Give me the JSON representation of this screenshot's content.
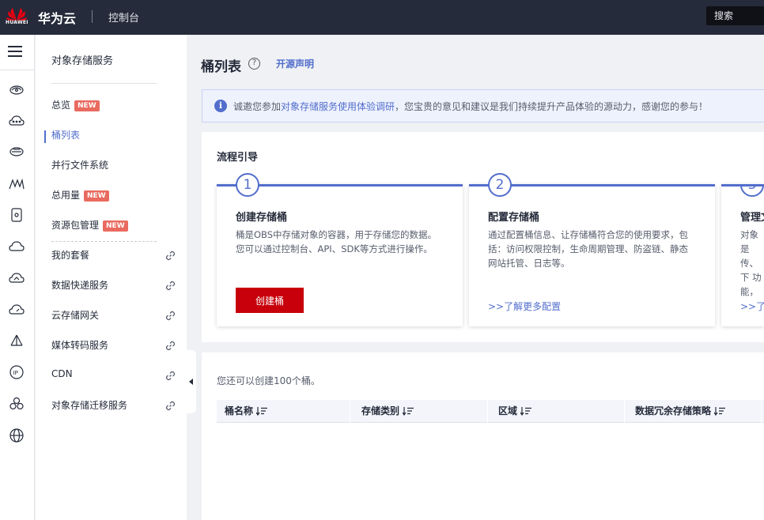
{
  "topbar": {
    "logo_text": "HUAWEI",
    "brand": "华为云",
    "console": "控制台",
    "search_placeholder": "搜索"
  },
  "rail_icons": [
    "menu-icon",
    "obs-icon",
    "cloud-dots-icon",
    "storage-icon",
    "mountain-icon",
    "drive-icon",
    "cloud-icon",
    "cloud-up-icon",
    "cloud-gauge-icon",
    "network-icon",
    "ip-icon",
    "cluster-icon",
    "globe-icon"
  ],
  "subnav": {
    "title": "对象存储服务",
    "items": [
      {
        "label": "总览",
        "badge": "NEW"
      },
      {
        "label": "桶列表",
        "active": true
      },
      {
        "label": "并行文件系统"
      },
      {
        "label": "总用量",
        "badge": "NEW"
      },
      {
        "label": "资源包管理",
        "badge": "NEW"
      },
      {
        "label": "我的套餐",
        "external": true
      },
      {
        "label": "数据快递服务",
        "external": true
      },
      {
        "label": "云存储网关",
        "external": true
      },
      {
        "label": "媒体转码服务",
        "external": true
      },
      {
        "label": "CDN",
        "external": true
      },
      {
        "label": "对象存储迁移服务",
        "external": true
      }
    ]
  },
  "header": {
    "title": "桶列表",
    "help_icon": "?",
    "open_source_link": "开源声明"
  },
  "notice": {
    "info_icon": "i",
    "prefix": "诚邀您参加",
    "link": "对象存储服务使用体验调研",
    "suffix": "，您宝贵的意见和建议是我们持续提升产品体验的源动力，感谢您的参与！"
  },
  "guide": {
    "title": "流程引导",
    "steps": [
      {
        "num": "1",
        "title": "创建存储桶",
        "desc": "桶是OBS中存储对象的容器，用于存储您的数据。您可以通过控制台、API、SDK等方式进行操作。",
        "button": "创建桶"
      },
      {
        "num": "2",
        "title": "配置存储桶",
        "desc": "通过配置桶信息、让存储桶符合您的使用要求，包括：访问权限控制，生命周期管理、防盗链、静态网站托管、日志等。",
        "link": ">>了解更多配置"
      },
      {
        "num": "3",
        "title": "管理文",
        "desc": "对象是 传、下 功能，",
        "link": ">>了解"
      }
    ]
  },
  "buckets": {
    "quota_text": "您还可以创建100个桶。",
    "columns": [
      "桶名称",
      "存储类别",
      "区域",
      "数据冗余存储策略"
    ]
  },
  "colors": {
    "accent": "#526ecc",
    "brand_red": "#c7000b",
    "topbar": "#252b3a",
    "badge": "#e96a5f"
  }
}
